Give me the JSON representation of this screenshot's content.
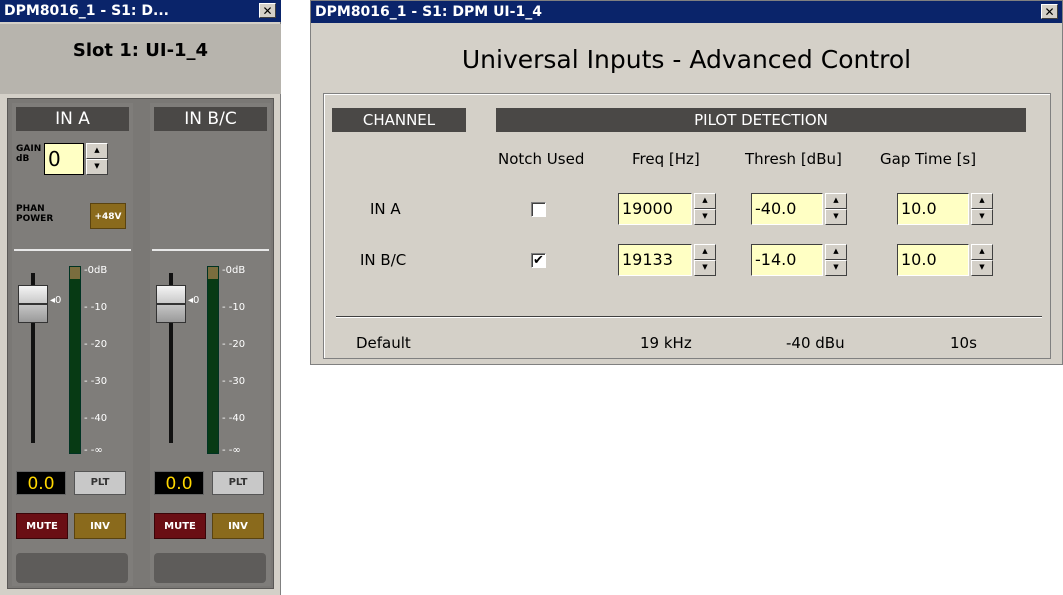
{
  "win1": {
    "title": "DPM8016_1 - S1: D...",
    "close": "✕",
    "slot_title": "Slot 1: UI-1_4",
    "channels": [
      {
        "name": "IN A",
        "gain_label": "GAIN\ndB",
        "gain_value": "0",
        "phantom_label": "PHAN\nPOWER",
        "phantom_button": "+48V",
        "fader_mark": "◂0",
        "level_value": "0.0",
        "plt": "PLT",
        "mute": "MUTE",
        "inv": "INV"
      },
      {
        "name": "IN B/C",
        "fader_mark": "◂0",
        "level_value": "0.0",
        "plt": "PLT",
        "mute": "MUTE",
        "inv": "INV"
      }
    ],
    "meter_scale": [
      "-0dB",
      "-10",
      "-20",
      "-30",
      "-40",
      "-∞"
    ]
  },
  "win2": {
    "title": "DPM8016_1 - S1: DPM UI-1_4",
    "close": "✕",
    "heading": "Universal Inputs - Advanced Control",
    "channel_header": "CHANNEL",
    "pilot_header": "PILOT DETECTION",
    "columns": [
      "Notch Used",
      "Freq [Hz]",
      "Thresh [dBu]",
      "Gap Time [s]"
    ],
    "rows": [
      {
        "label": "IN A",
        "notch": "",
        "freq": "19000",
        "thresh": "-40.0",
        "gap": "10.0"
      },
      {
        "label": "IN B/C",
        "notch": "✔",
        "freq": "19133",
        "thresh": "-14.0",
        "gap": "10.0"
      }
    ],
    "default_label": "Default",
    "defaults": [
      "19 kHz",
      "-40 dBu",
      "10s"
    ]
  }
}
